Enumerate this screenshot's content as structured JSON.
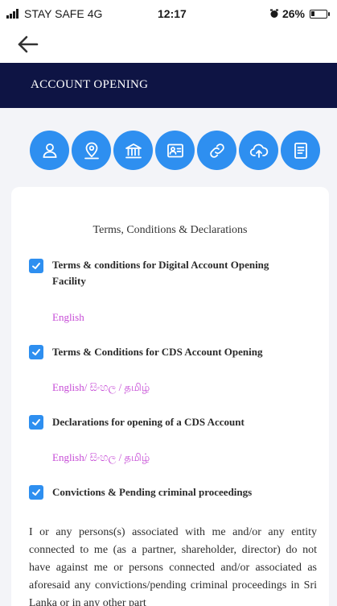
{
  "status_bar": {
    "carrier": "STAY SAFE",
    "network": "4G",
    "time": "12:17",
    "battery_percent": "26%",
    "battery_level": 0.26
  },
  "nav": {
    "back_icon": "arrow-left-icon"
  },
  "header": {
    "title": "ACCOUNT OPENING",
    "background": "#0e1444"
  },
  "steps": {
    "accent": "#2e8ff0",
    "icons": [
      "user-icon",
      "location-icon",
      "bank-icon",
      "id-card-icon",
      "link-icon",
      "cloud-upload-icon",
      "document-icon"
    ]
  },
  "terms": {
    "title": "Terms, Conditions & Declarations",
    "items": [
      {
        "label_line1": "Terms & conditions for Digital Account Opening",
        "label_line2": "Facility",
        "link": "English",
        "checked": true
      },
      {
        "label": "Terms & Conditions for CDS Account Opening",
        "link": "English/ සිංහල / தமிழ்",
        "checked": true
      },
      {
        "label": "Declarations for opening of a CDS Account",
        "link": "English/ සිංහල / தமிழ்",
        "checked": true
      },
      {
        "label": "Convictions & Pending criminal proceedings",
        "checked": true
      }
    ],
    "paragraph": "I or any persons(s) associated with me and/or any entity connected to me (as a partner, shareholder, director) do not have against me or persons connected and/or associated as aforesaid any convictions/pending criminal proceedings in Sri Lanka or in any other part"
  }
}
